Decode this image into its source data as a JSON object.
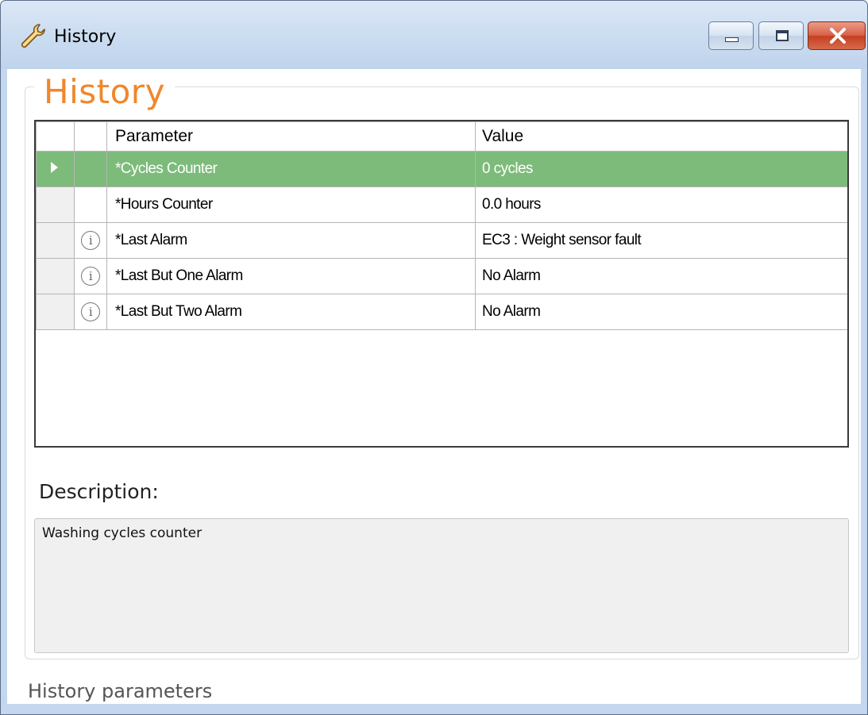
{
  "window": {
    "title": "History",
    "icon": "wrench-icon",
    "buttons": [
      "minimize",
      "maximize",
      "close"
    ]
  },
  "group": {
    "title": "History"
  },
  "grid": {
    "columns": [
      "",
      "",
      "Parameter",
      "Value"
    ],
    "selected_row": 0,
    "rows": [
      {
        "info": false,
        "parameter": "*Cycles Counter",
        "value": "0 cycles"
      },
      {
        "info": false,
        "parameter": "*Hours Counter",
        "value": "0.0 hours"
      },
      {
        "info": true,
        "parameter": "*Last Alarm",
        "value": "EC3 : Weight sensor fault"
      },
      {
        "info": true,
        "parameter": "*Last But One Alarm",
        "value": "No Alarm"
      },
      {
        "info": true,
        "parameter": "*Last But Two Alarm",
        "value": "No Alarm"
      }
    ],
    "selection_color": "#7dbb7a"
  },
  "description": {
    "label": "Description:",
    "text": "Washing cycles counter"
  },
  "footer": {
    "text": "History parameters"
  },
  "colors": {
    "accent_title": "#f0872c",
    "close_button": "#c4401f"
  }
}
